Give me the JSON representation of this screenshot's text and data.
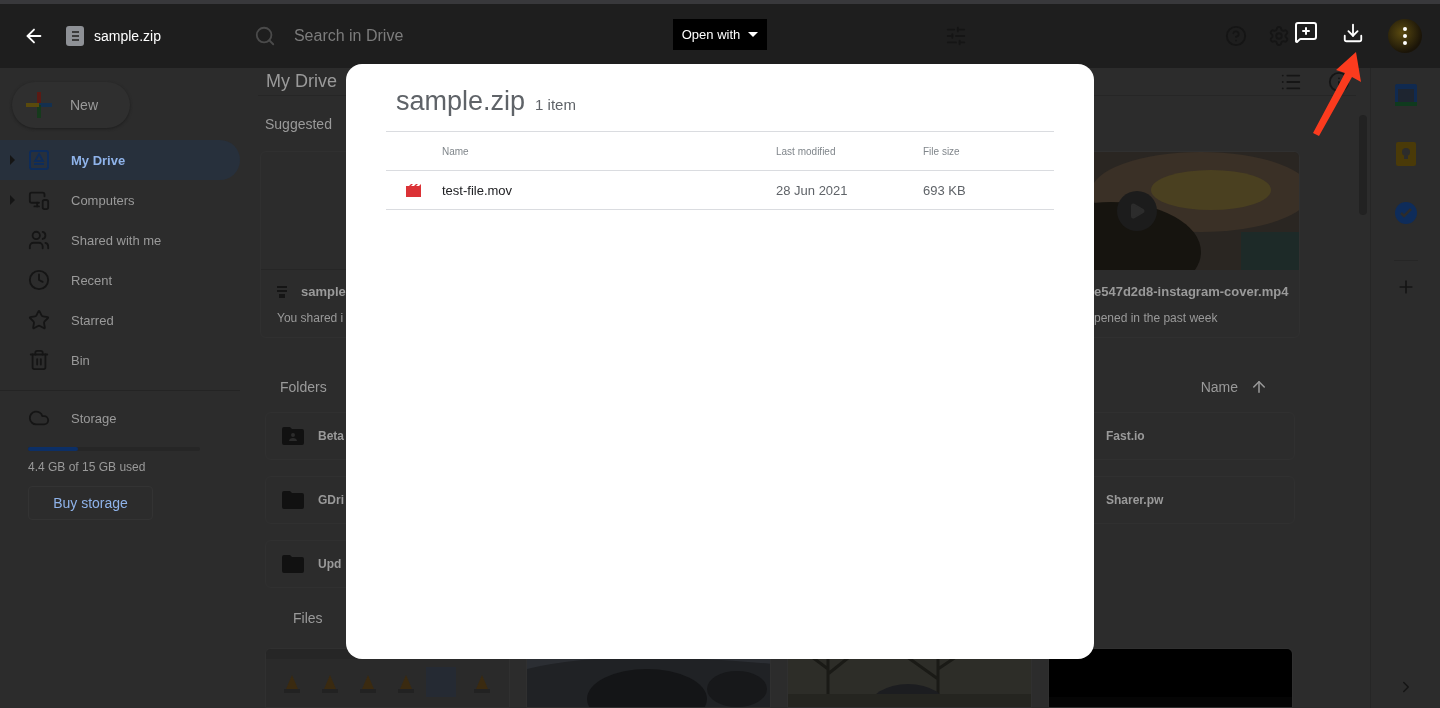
{
  "viewer": {
    "file_name": "sample.zip",
    "search_placeholder": "Search in Drive",
    "open_with": "Open with"
  },
  "sidebar": {
    "new_button": "New",
    "items": [
      {
        "label": "My Drive",
        "kind": "drive",
        "selected": true,
        "expandable": true
      },
      {
        "label": "Computers",
        "kind": "computers",
        "selected": false,
        "expandable": true
      },
      {
        "label": "Shared with me",
        "kind": "shared",
        "selected": false,
        "expandable": false
      },
      {
        "label": "Recent",
        "kind": "recent",
        "selected": false,
        "expandable": false
      },
      {
        "label": "Starred",
        "kind": "starred",
        "selected": false,
        "expandable": false
      },
      {
        "label": "Bin",
        "kind": "bin",
        "selected": false,
        "expandable": false
      }
    ],
    "storage": {
      "label": "Storage",
      "level": 0.29,
      "usage": "4.4 GB of 15 GB used",
      "buy_button": "Buy storage"
    }
  },
  "main": {
    "title": "My Drive",
    "suggested": {
      "heading": "Suggested",
      "cards": [
        {
          "kind": "file",
          "name": "sample",
          "detail": "You shared i"
        },
        {
          "kind": "video",
          "name": "e547d2d8-instagram-cover.mp4",
          "detail": "pened in the past week"
        }
      ]
    },
    "folders": {
      "heading": "Folders",
      "sort_label": "Name",
      "rows": [
        {
          "left": {
            "name": "Beta",
            "kind": "shared"
          },
          "right": {
            "name": "Fast.io"
          }
        },
        {
          "left": {
            "name": "GDri",
            "kind": "folder"
          },
          "right": {
            "name": "Sharer.pw"
          }
        },
        {
          "left": {
            "name": "Upd",
            "kind": "folder"
          }
        }
      ]
    },
    "files": {
      "heading": "Files"
    }
  },
  "dialog": {
    "title": "sample.zip",
    "count": "1 item",
    "columns": [
      "Name",
      "Last modified",
      "File size"
    ],
    "rows": [
      {
        "kind": "video",
        "name": "test-file.mov",
        "modified": "28 Jun 2021",
        "size": "693 KB"
      }
    ]
  }
}
